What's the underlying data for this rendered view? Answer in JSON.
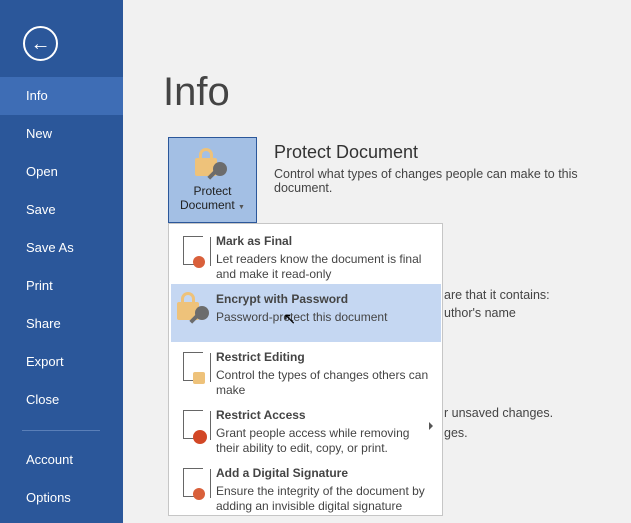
{
  "sidebar": {
    "back_icon": "back-arrow-icon",
    "items": [
      {
        "label": "Info"
      },
      {
        "label": "New"
      },
      {
        "label": "Open"
      },
      {
        "label": "Save"
      },
      {
        "label": "Save As"
      },
      {
        "label": "Print"
      },
      {
        "label": "Share"
      },
      {
        "label": "Export"
      },
      {
        "label": "Close"
      },
      {
        "label": "Account"
      },
      {
        "label": "Options"
      }
    ],
    "selected": "Info",
    "color": "#2b579a",
    "selected_color": "#3e6db5"
  },
  "page": {
    "title": "Info"
  },
  "protect": {
    "button_line1": "Protect",
    "button_line2": "Document",
    "title": "Protect Document",
    "description": "Control what types of changes people can make to this document."
  },
  "background_text": [
    "are that it contains:",
    "uthor's name",
    "r unsaved changes.",
    "ges."
  ],
  "menu": {
    "items": [
      {
        "title": "Mark as Final",
        "description": "Let readers know the document is final and make it read-only",
        "icon": "mark-final-icon"
      },
      {
        "title": "Encrypt with Password",
        "description": "Password-protect this document",
        "icon": "lock-key-icon",
        "highlighted": true
      },
      {
        "title": "Restrict Editing",
        "description": "Control the types of changes others can make",
        "icon": "restrict-editing-icon"
      },
      {
        "title": "Restrict Access",
        "description": "Grant people access while removing their ability to edit, copy, or print.",
        "icon": "restrict-access-icon",
        "has_submenu": true
      },
      {
        "title": "Add a Digital Signature",
        "description": "Ensure the integrity of the document by adding an invisible digital signature",
        "icon": "digital-signature-icon"
      }
    ]
  }
}
